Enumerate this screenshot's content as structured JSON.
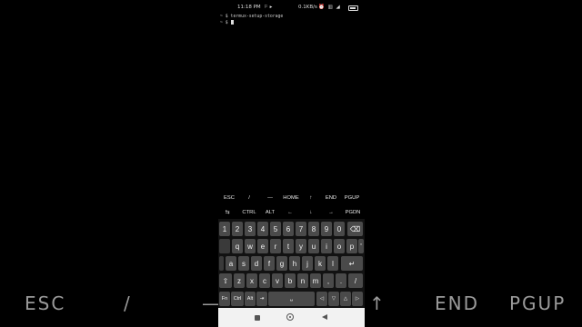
{
  "background": {
    "extra_keys": [
      "ESC",
      "/",
      "—",
      "↑",
      "END",
      "PGUP"
    ]
  },
  "status_bar": {
    "time": "11:18 PM",
    "indicators": "⚐ ▸",
    "speed": "0.1KB/s",
    "icons": "⏰ ▥ ◢",
    "battery_icon": "battery-icon"
  },
  "terminal": {
    "lines": [
      "~ $ termux-setup-storage",
      "~ $ "
    ]
  },
  "extra_keys": {
    "row1": [
      "ESC",
      "/",
      "—",
      "HOME",
      "↑",
      "END",
      "PGUP"
    ],
    "row2": [
      "⇆",
      "CTRL",
      "ALT",
      "←",
      "↓",
      "→",
      "PGDN"
    ]
  },
  "keyboard": {
    "numbers": [
      "1",
      "2",
      "3",
      "4",
      "5",
      "6",
      "7",
      "8",
      "9",
      "0",
      "⌫"
    ],
    "row_q": [
      "q",
      "w",
      "e",
      "r",
      "t",
      "y",
      "u",
      "i",
      "o",
      "p",
      "'"
    ],
    "row_a": [
      "a",
      "s",
      "d",
      "f",
      "g",
      "h",
      "j",
      "k",
      "l",
      "↵"
    ],
    "row_z": [
      "⇧",
      "z",
      "x",
      "c",
      "v",
      "b",
      "n",
      "m",
      ",",
      ".",
      "/"
    ],
    "bottom": [
      "Fn",
      "Ctrl",
      "Alt",
      "⇥",
      "␣",
      "◁",
      "▽",
      "△",
      "▷"
    ]
  },
  "colors": {
    "background": "#000000",
    "key": "#4a4a4a",
    "navbar": "#f2f2f2"
  }
}
